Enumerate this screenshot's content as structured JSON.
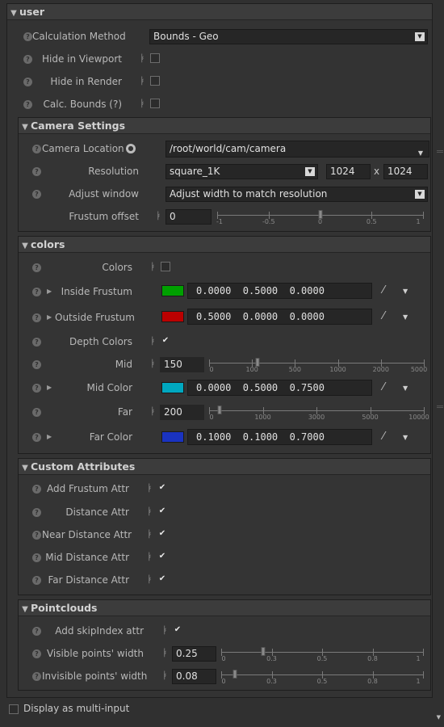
{
  "user": {
    "title": "user",
    "calc_method": {
      "label": "Calculation Method",
      "value": "Bounds - Geo"
    },
    "hide_viewport": {
      "label": "Hide in Viewport",
      "checked": false
    },
    "hide_render": {
      "label": "Hide in Render",
      "checked": false
    },
    "calc_bounds": {
      "label": "Calc. Bounds (?)",
      "checked": false
    }
  },
  "camera": {
    "title": "Camera Settings",
    "location": {
      "label": "Camera Location",
      "value": "/root/world/cam/camera"
    },
    "resolution": {
      "label": "Resolution",
      "value": "square_1K",
      "width": "1024",
      "sep": "x",
      "height": "1024"
    },
    "adjust": {
      "label": "Adjust window",
      "value": "Adjust width to match resolution"
    },
    "frustum": {
      "label": "Frustum offset",
      "value": "0",
      "min": -1,
      "max": 1,
      "current": 0,
      "ticks": [
        {
          "v": -1,
          "t": "-1"
        },
        {
          "v": -0.5,
          "t": "-0.5"
        },
        {
          "v": 0,
          "t": "0"
        },
        {
          "v": 0.5,
          "t": "0.5"
        },
        {
          "v": 1,
          "t": "1"
        }
      ]
    }
  },
  "colors": {
    "title": "colors",
    "colors_toggle": {
      "label": "Colors",
      "checked": false
    },
    "inside": {
      "label": "Inside Frustum",
      "value": "0.0000  0.5000  0.0000",
      "swatch": "#00a000"
    },
    "outside": {
      "label": "Outside Frustum",
      "value": "0.5000  0.0000  0.0000",
      "swatch": "#bb0000"
    },
    "depth": {
      "label": "Depth Colors",
      "checked": true
    },
    "mid": {
      "label": "Mid",
      "value": "150",
      "min": 0,
      "max": 5000,
      "current": 150,
      "ticks": [
        {
          "v": 0,
          "t": "0"
        },
        {
          "v": 100,
          "t": "100"
        },
        {
          "v": 500,
          "t": "500"
        },
        {
          "v": 1000,
          "t": "1000"
        },
        {
          "v": 2000,
          "t": "2000"
        },
        {
          "v": 5000,
          "t": "5000"
        }
      ]
    },
    "mid_color": {
      "label": "Mid Color",
      "value": "0.0000  0.5000  0.7500",
      "swatch": "#00a8c0"
    },
    "far": {
      "label": "Far",
      "value": "200",
      "min": 0,
      "max": 10000,
      "current": 200,
      "ticks": [
        {
          "v": 0,
          "t": "0"
        },
        {
          "v": 1000,
          "t": "1000"
        },
        {
          "v": 3000,
          "t": "3000"
        },
        {
          "v": 5000,
          "t": "5000"
        },
        {
          "v": 10000,
          "t": "10000"
        }
      ]
    },
    "far_color": {
      "label": "Far Color",
      "value": "0.1000  0.1000  0.7000",
      "swatch": "#1a33c0"
    }
  },
  "custom": {
    "title": "Custom Attributes",
    "add_frustum": {
      "label": "Add Frustum Attr",
      "checked": true
    },
    "distance": {
      "label": "Distance Attr",
      "checked": true
    },
    "near_distance": {
      "label": "Near Distance Attr",
      "checked": true
    },
    "mid_distance": {
      "label": "Mid Distance Attr",
      "checked": true
    },
    "far_distance": {
      "label": "Far Distance Attr",
      "checked": true
    }
  },
  "pointclouds": {
    "title": "Pointclouds",
    "skip_index": {
      "label": "Add skipIndex attr",
      "checked": true
    },
    "visible": {
      "label": "Visible points' width",
      "value": "0.25",
      "min": 0,
      "max": 1,
      "current": 0.25,
      "ticks": [
        {
          "v": 0,
          "t": "0"
        },
        {
          "v": 0.3,
          "t": "0.3"
        },
        {
          "v": 0.5,
          "t": "0.5"
        },
        {
          "v": 0.8,
          "t": "0.8"
        },
        {
          "v": 1,
          "t": "1"
        }
      ]
    },
    "invisible": {
      "label": "Invisible points' width",
      "value": "0.08",
      "min": 0,
      "max": 1,
      "current": 0.08,
      "ticks": [
        {
          "v": 0,
          "t": "0"
        },
        {
          "v": 0.3,
          "t": "0.3"
        },
        {
          "v": 0.5,
          "t": "0.5"
        },
        {
          "v": 0.8,
          "t": "0.8"
        },
        {
          "v": 1,
          "t": "1"
        }
      ]
    }
  },
  "footer": {
    "multi_input": {
      "label": "Display as multi-input",
      "checked": false
    }
  },
  "icons": {
    "help": "help-icon",
    "key": "animation-key-icon",
    "picker": "color-picker-icon",
    "link": "link-icon"
  }
}
